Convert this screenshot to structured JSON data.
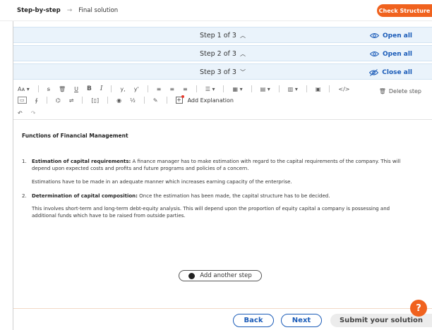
{
  "breadcrumb": {
    "active": "Step-by-step",
    "next": "Final solution"
  },
  "header": {
    "check_label": "Check Structure"
  },
  "steps": [
    {
      "title": "Step 1 of 3",
      "toggle": "Open all",
      "expanded": false
    },
    {
      "title": "Step 2 of 3",
      "toggle": "Open all",
      "expanded": false
    },
    {
      "title": "Step 3 of 3",
      "toggle": "Close all",
      "expanded": true
    }
  ],
  "toolbar": {
    "font_size_label": "Aᴀ",
    "bold": "B",
    "italic": "I",
    "subscript": "y,",
    "superscript": "y'",
    "code": "</>",
    "delete_step": "Delete step",
    "add_explanation": "Add Explanation",
    "colors": {
      "accent": "#1a5bb8",
      "brand": "#f0621e"
    }
  },
  "document": {
    "title": "Functions of Financial Management",
    "items": [
      {
        "num": "1.",
        "heading": "Estimation of capital requirements:",
        "text": " A finance manager has to make estimation with regard to the capital requirements of the company. This will depend upon expected costs and profits and future programs and policies of a concern.",
        "para": "Estimations have to be made in an adequate manner which increases earning capacity of the enterprise."
      },
      {
        "num": "2.",
        "heading": "Determination of capital composition:",
        "text": " Once the estimation has been made, the capital structure has to be decided.",
        "para": "This involves short-term and long-term debt-equity analysis. This will depend upon the proportion of equity capital a company is possessing and additional funds which have to be raised from outside parties."
      }
    ]
  },
  "actions": {
    "add_step": "Add another step",
    "back": "Back",
    "next": "Next",
    "submit": "Submit your solution",
    "help": "?"
  }
}
